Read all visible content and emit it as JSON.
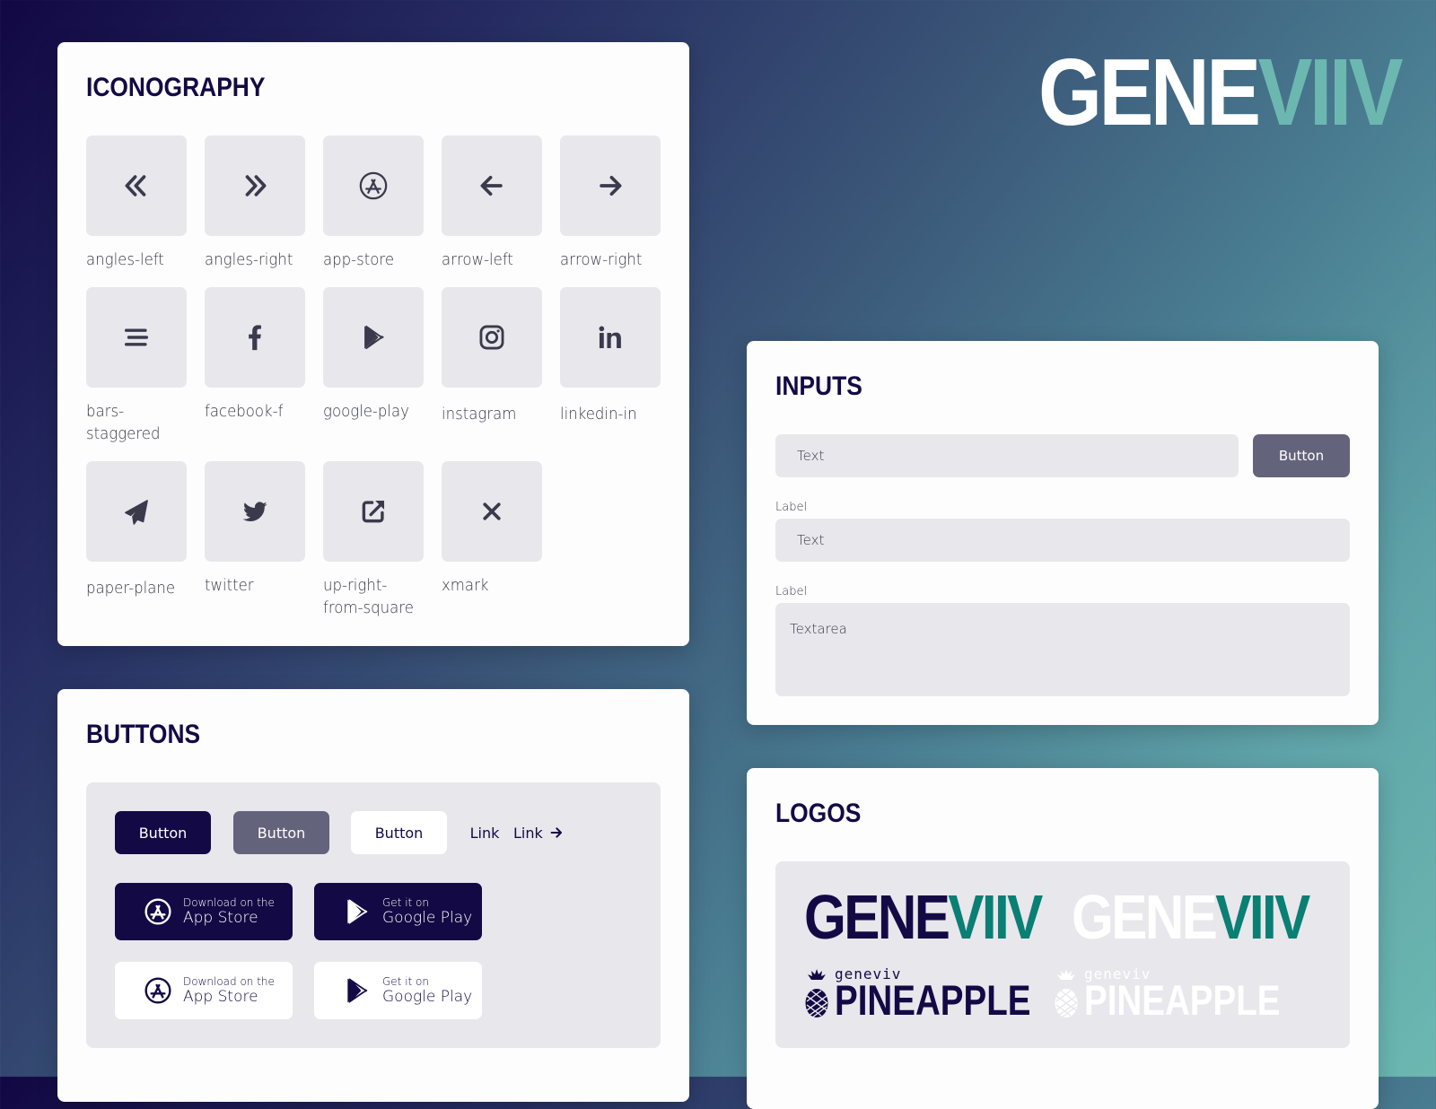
{
  "colors": {
    "brand_dark": "#130a45",
    "brand_teal": "#0a7f74",
    "brand_teal_light": "#6cb8b1",
    "button_secondary": "#64637c",
    "surface": "#e8e7ec",
    "icon": "#3b3a4c"
  },
  "brand": {
    "logo_part1": "GENE",
    "logo_part2": "VIIV"
  },
  "iconography": {
    "title": "ICONOGRAPHY",
    "icons": [
      {
        "name": "angles-left",
        "label": "angles-left"
      },
      {
        "name": "angles-right",
        "label": "angles-right"
      },
      {
        "name": "app-store",
        "label": "app-store"
      },
      {
        "name": "arrow-left",
        "label": "arrow-left"
      },
      {
        "name": "arrow-right",
        "label": "arrow-right"
      },
      {
        "name": "bars-staggered",
        "label": "bars-staggered"
      },
      {
        "name": "facebook-f",
        "label": "facebook-f"
      },
      {
        "name": "google-play",
        "label": "google-play"
      },
      {
        "name": "instagram",
        "label": "instagram"
      },
      {
        "name": "linkedin-in",
        "label": "linkedin-in"
      },
      {
        "name": "paper-plane",
        "label": "paper-plane"
      },
      {
        "name": "twitter",
        "label": "twitter"
      },
      {
        "name": "up-right-from-square",
        "label": "up-right-from-square"
      },
      {
        "name": "xmark",
        "label": "xmark"
      }
    ]
  },
  "inputs": {
    "title": "INPUTS",
    "inline_field": {
      "value": "Text"
    },
    "inline_button": "Button",
    "labeled_field": {
      "label": "Label",
      "value": "Text"
    },
    "textarea": {
      "label": "Label",
      "value": "Textarea"
    }
  },
  "buttons": {
    "title": "BUTTONS",
    "primary": "Button",
    "secondary": "Button",
    "white": "Button",
    "link": "Link",
    "link_arrow": "Link",
    "app_store_dark": {
      "small": "Download on the",
      "big": "App Store"
    },
    "google_play_dark": {
      "small": "Get it on",
      "big": "Google Play"
    },
    "app_store_light": {
      "small": "Download on the",
      "big": "App Store"
    },
    "google_play_light": {
      "small": "Get it on",
      "big": "Google Play"
    }
  },
  "logos": {
    "title": "LOGOS",
    "geneviv_part1": "GENE",
    "geneviv_part2": "VIIV",
    "pineapple_small": "geneviv",
    "pineapple_big": "PINEAPPLE"
  }
}
